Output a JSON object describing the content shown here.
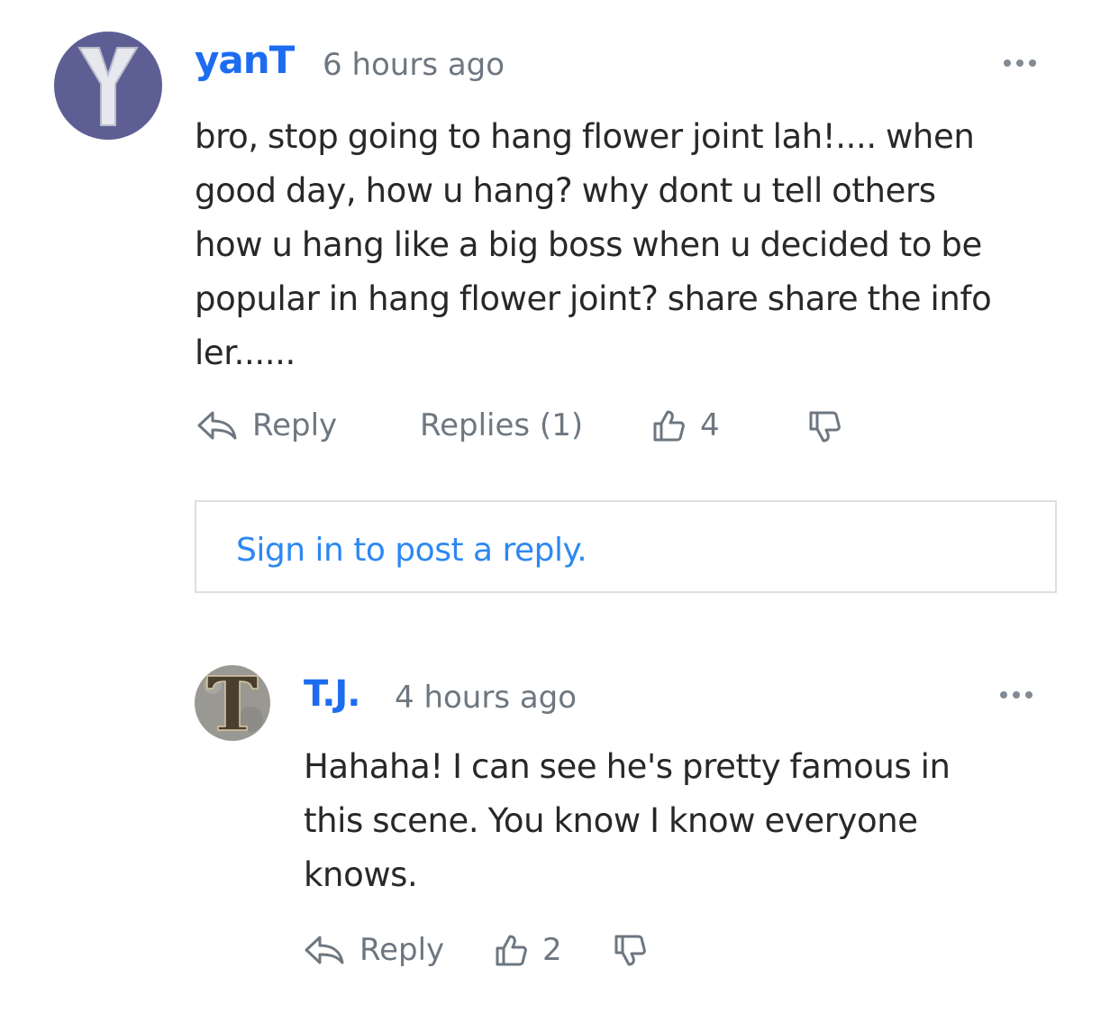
{
  "comments": [
    {
      "avatar_letter": "Y",
      "author": "yanT",
      "time": "6 hours ago",
      "text_lines": [
        "bro, stop going to hang flower joint lah!.... when",
        "good day, how u hang? why dont u tell others",
        "how u hang like a big boss when u decided to be",
        "popular in hang flower joint? share share the info",
        "ler......"
      ],
      "reply_label": "Reply",
      "replies_label": "Replies (1)",
      "likes": "4"
    },
    {
      "avatar_letter": "T",
      "author": "T.J.",
      "time": "4 hours ago",
      "text_lines": [
        "Hahaha! I can see he's pretty famous in",
        "this scene. You know I know everyone",
        "knows."
      ],
      "reply_label": "Reply",
      "likes": "2"
    }
  ],
  "signin": {
    "label": "Sign in to post a reply."
  },
  "colors": {
    "author": "#1d6cf0",
    "link": "#2d88f3",
    "meta": "#6e7780",
    "text": "#26282a",
    "border": "#dcdfe3"
  },
  "icons": [
    "reply-arrow-icon",
    "thumbs-up-icon",
    "thumbs-down-icon",
    "more-options-icon"
  ]
}
